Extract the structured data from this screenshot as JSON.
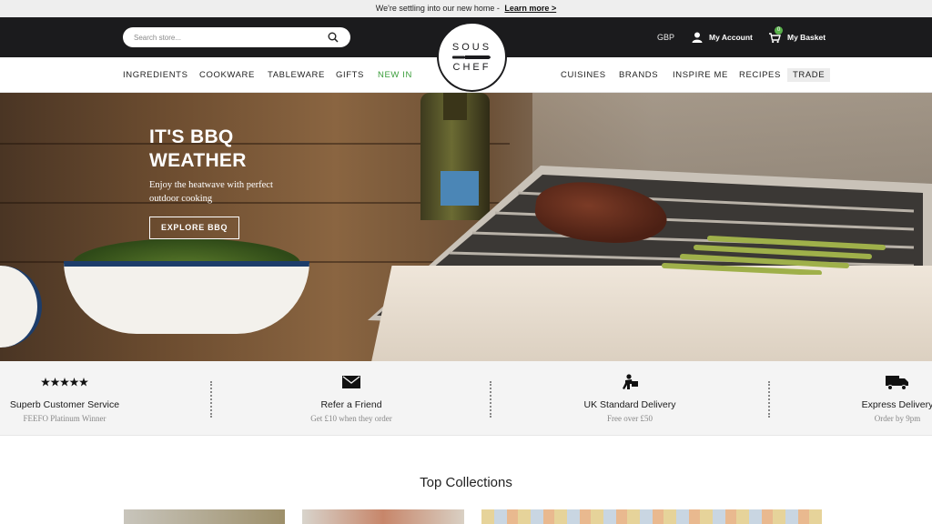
{
  "announcement": {
    "text": "We're settling into our new home -",
    "link": "Learn more >"
  },
  "search": {
    "placeholder": "Search store..."
  },
  "header": {
    "currency": "GBP",
    "account_label": "My Account",
    "basket_label": "My Basket",
    "basket_count": "0"
  },
  "logo": {
    "line1": "SOUS",
    "line2": "CHEF"
  },
  "nav": {
    "left": [
      "INGREDIENTS",
      "COOKWARE",
      "TABLEWARE",
      "GIFTS",
      "NEW IN"
    ],
    "right": [
      "CUISINES",
      "BRANDS",
      "INSPIRE ME",
      "RECIPES",
      "TRADE"
    ]
  },
  "hero": {
    "title": "IT'S BBQ\nWEATHER",
    "subtitle": "Enjoy the heatwave with perfect outdoor cooking",
    "button": "EXPLORE BBQ"
  },
  "usps": [
    {
      "icon": "five-stars-icon",
      "title": "Superb Customer Service",
      "subtitle": "FEEFO Platinum Winner"
    },
    {
      "icon": "envelope-icon",
      "title": "Refer a Friend",
      "subtitle": "Get £10 when they order"
    },
    {
      "icon": "delivery-person-icon",
      "title": "UK Standard Delivery",
      "subtitle": "Free over £50"
    },
    {
      "icon": "delivery-truck-icon",
      "title": "Express Delivery",
      "subtitle": "Order by 9pm"
    }
  ],
  "collections": {
    "title": "Top Collections"
  },
  "colors": {
    "header_bg": "#1b1b1d",
    "new_in": "#3a9d3a",
    "badge": "#59b04b",
    "usp_bg": "#f4f4f4"
  }
}
